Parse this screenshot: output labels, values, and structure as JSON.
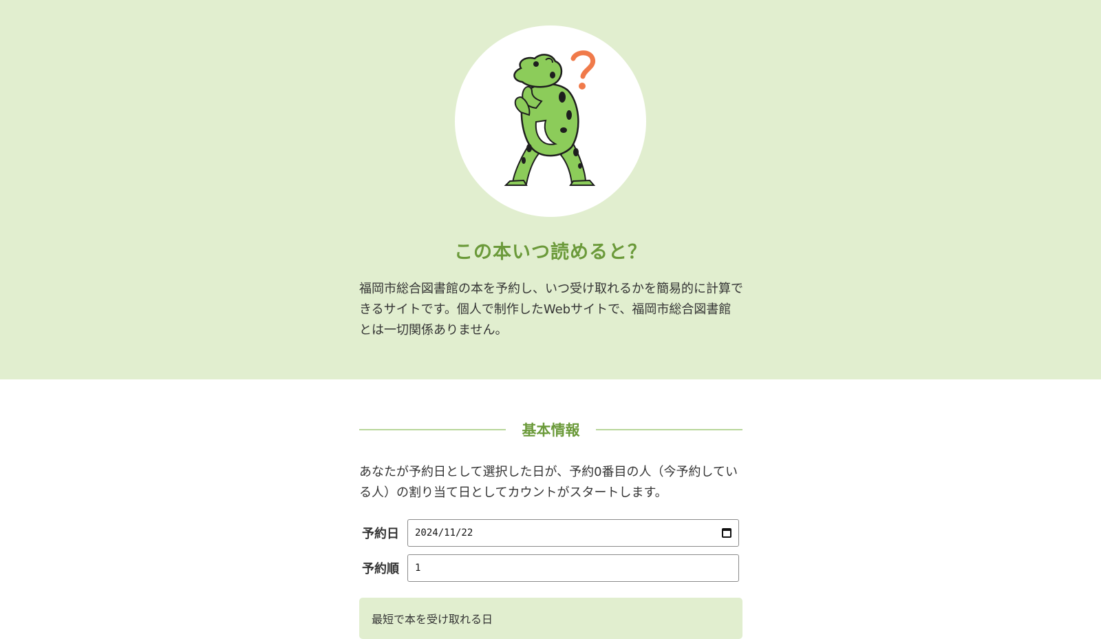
{
  "hero": {
    "title": "この本いつ読めると？",
    "description": "福岡市総合図書館の本を予約し、いつ受け取れるかを簡易的に計算できるサイトです。個人で制作したWebサイトで、福岡市総合図書館とは一切関係ありません。",
    "illustration": "frog-question-icon"
  },
  "section": {
    "heading": "基本情報",
    "description": "あなたが予約日として選択した日が、予約0番目の人（今予約している人）の割り当て日としてカウントがスタートします。"
  },
  "form": {
    "date_label": "予約日",
    "date_value": "2024/11/22",
    "order_label": "予約順",
    "order_value": "1"
  },
  "result": {
    "label": "最短で本を受け取れる日"
  },
  "colors": {
    "hero_bg": "#e1eecf",
    "accent": "#6b9a3a",
    "divider": "#b7d699"
  }
}
